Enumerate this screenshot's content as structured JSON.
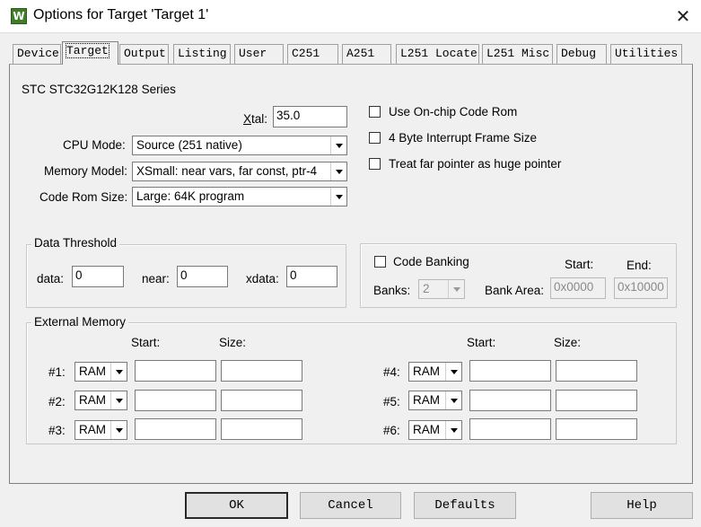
{
  "window": {
    "title": "Options for Target 'Target 1'",
    "app_icon_glyph": "W",
    "close_glyph": "✕"
  },
  "tabs": [
    {
      "label": "Device"
    },
    {
      "label": "Target"
    },
    {
      "label": "Output"
    },
    {
      "label": "Listing"
    },
    {
      "label": "User"
    },
    {
      "label": "C251"
    },
    {
      "label": "A251"
    },
    {
      "label": "L251 Locate"
    },
    {
      "label": "L251 Misc"
    },
    {
      "label": "Debug"
    },
    {
      "label": "Utilities"
    }
  ],
  "active_tab": "Target",
  "target": {
    "device_series": "STC STC32G12K128 Series",
    "xtal_label": "Xtal:",
    "xtal_value": "35.0",
    "cpu_mode_label": "CPU Mode:",
    "cpu_mode_value": "Source (251 native)",
    "memory_model_label": "Memory Model:",
    "memory_model_value": "XSmall: near vars, far const, ptr-4",
    "code_rom_size_label": "Code Rom Size:",
    "code_rom_size_value": "Large: 64K program",
    "options": [
      {
        "label": "Use On-chip Code Rom",
        "checked": false
      },
      {
        "label": "4 Byte Interrupt Frame Size",
        "checked": false
      },
      {
        "label": "Treat far pointer as huge pointer",
        "checked": false
      }
    ]
  },
  "data_threshold": {
    "title": "Data Threshold",
    "data_label": "data:",
    "data_value": "0",
    "near_label": "near:",
    "near_value": "0",
    "xdata_label": "xdata:",
    "xdata_value": "0"
  },
  "code_banking": {
    "label": "Code Banking",
    "checked": false,
    "start_label": "Start:",
    "end_label": "End:",
    "banks_label": "Banks:",
    "banks_value": "2",
    "bank_area_label": "Bank Area:",
    "bank_area_start": "0x0000",
    "bank_area_end": "0x10000"
  },
  "external_memory": {
    "title": "External Memory",
    "start_header": "Start:",
    "size_header": "Size:",
    "rows": [
      {
        "label": "#1:",
        "type": "RAM",
        "start": "",
        "size": ""
      },
      {
        "label": "#2:",
        "type": "RAM",
        "start": "",
        "size": ""
      },
      {
        "label": "#3:",
        "type": "RAM",
        "start": "",
        "size": ""
      },
      {
        "label": "#4:",
        "type": "RAM",
        "start": "",
        "size": ""
      },
      {
        "label": "#5:",
        "type": "RAM",
        "start": "",
        "size": ""
      },
      {
        "label": "#6:",
        "type": "RAM",
        "start": "",
        "size": ""
      }
    ]
  },
  "buttons": {
    "ok": "OK",
    "cancel": "Cancel",
    "defaults": "Defaults",
    "help": "Help"
  }
}
